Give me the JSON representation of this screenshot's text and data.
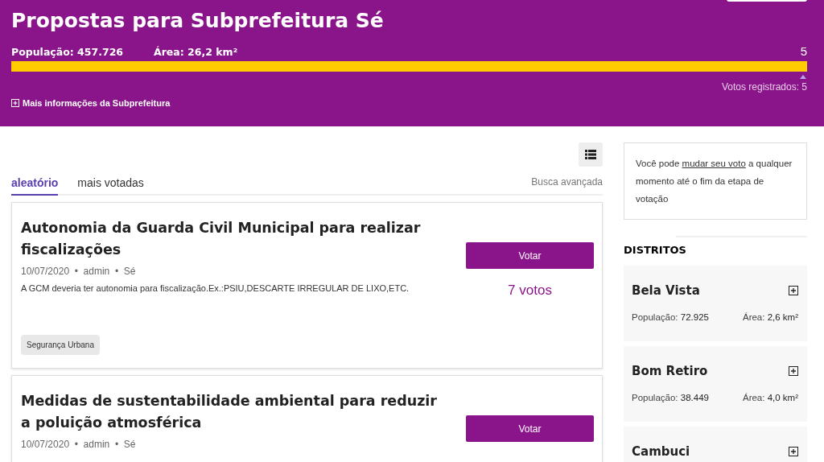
{
  "header": {
    "title": "Propostas para Subprefeitura Sé",
    "population": "População: 457.726",
    "area": "Área: 26,2 km²",
    "progress": {
      "count": "5",
      "level": 1
    },
    "votes_registered": "Votos registrados: 5",
    "more_info": "Mais informações da Subprefeitura"
  },
  "tabs": [
    {
      "label": "aleatório",
      "selected": true
    },
    {
      "label": "mais votadas",
      "selected": false
    }
  ],
  "advanced_search": "Busca avançada",
  "proposals": [
    {
      "title": "Autonomia da Guarda Civil Municipal para realizar fiscalizações",
      "meta": "10/07/2020  •  admin  •  Sé",
      "description": "A GCM deveria ter autonomia para fiscalização.Ex.:PSIU,DESCARTE IRREGULAR DE LIXO,ETC.",
      "tag": "Segurança Urbana",
      "button": "Votar",
      "votes": "7 votos"
    },
    {
      "title": "Medidas de sustentabilidade ambiental para reduzir a poluição atmosférica",
      "meta": "10/07/2020  •  admin  •  Sé",
      "button": "Votar"
    }
  ],
  "notice": {
    "before": "Você pode ",
    "link": "mudar seu voto",
    "after": " a qualquer momento até o fim da etapa de votação"
  },
  "districts_heading": "DISTRITOS",
  "districts": [
    {
      "name": "Bela Vista",
      "population_label": "População:",
      "population": "72.925",
      "area_label": "Área:",
      "area": "2,6 km²"
    },
    {
      "name": "Bom Retiro",
      "population_label": "População:",
      "population": "38.449",
      "area_label": "Área:",
      "area": "4,0 km²"
    },
    {
      "name": "Cambuci"
    }
  ]
}
